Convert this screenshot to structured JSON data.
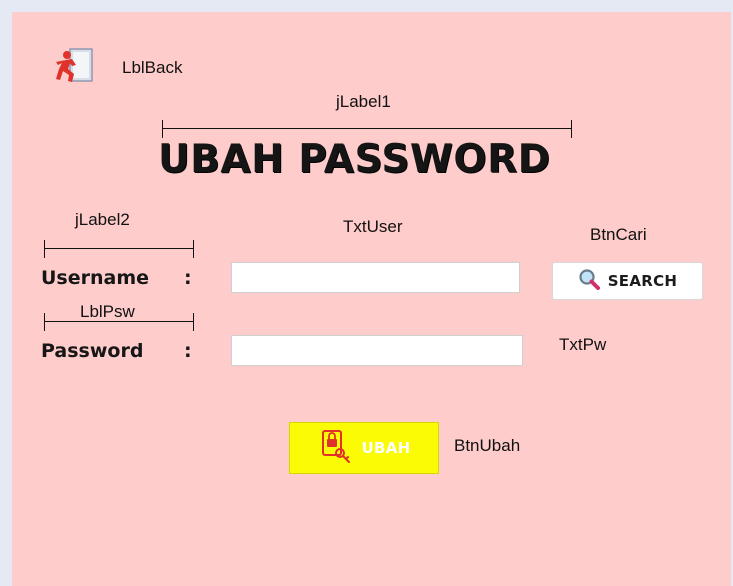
{
  "annotations": {
    "lbl_back": "LblBack",
    "jlabel1": "jLabel1",
    "jlabel2": "jLabel2",
    "txt_user": "TxtUser",
    "btn_cari": "BtnCari",
    "lbl_psw": "LblPsw",
    "txt_pw": "TxtPw",
    "btn_ubah": "BtnUbah"
  },
  "form": {
    "title": "UBAH PASSWORD",
    "username_label": "Username",
    "password_label": "Password",
    "colon": ":",
    "username_value": "",
    "password_value": ""
  },
  "buttons": {
    "search_label": "SEARCH",
    "ubah_label": "UBAH"
  },
  "icons": {
    "back": "exit-person-icon",
    "search": "magnifier-icon",
    "ubah": "lock-key-icon"
  },
  "colors": {
    "panel_background": "#fdcccb",
    "window_background": "#e5e9f4",
    "ubah_button": "#fbfb05",
    "icon_accent": "#e0322a"
  }
}
